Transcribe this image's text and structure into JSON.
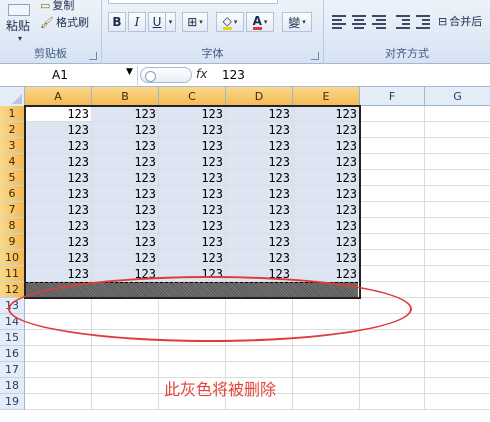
{
  "ribbon": {
    "clipboard": {
      "paste_label": "粘贴",
      "copy_label": "复制",
      "format_painter_label": "格式刷",
      "group_label": "剪贴板"
    },
    "font": {
      "bold": "B",
      "italic": "I",
      "underline": "U",
      "font_color_glyph": "A",
      "phonetic_glyph": "變",
      "group_label": "字体"
    },
    "alignment": {
      "merge_label": "合并后",
      "group_label": "对齐方式"
    }
  },
  "formula_bar": {
    "name_box": "A1",
    "fx": "fx",
    "value": "123"
  },
  "sheet": {
    "columns": [
      "A",
      "B",
      "C",
      "D",
      "E",
      "F",
      "G"
    ],
    "rows": [
      "1",
      "2",
      "3",
      "4",
      "5",
      "6",
      "7",
      "8",
      "9",
      "10",
      "11",
      "12",
      "13",
      "14",
      "15",
      "16",
      "17",
      "18",
      "19"
    ],
    "cell_value": "123",
    "filled_rows": 11,
    "filled_cols": 5,
    "deleted_row": "12"
  },
  "annotation": {
    "note": "此灰色将被删除",
    "oval_color": "#e03b3b"
  }
}
